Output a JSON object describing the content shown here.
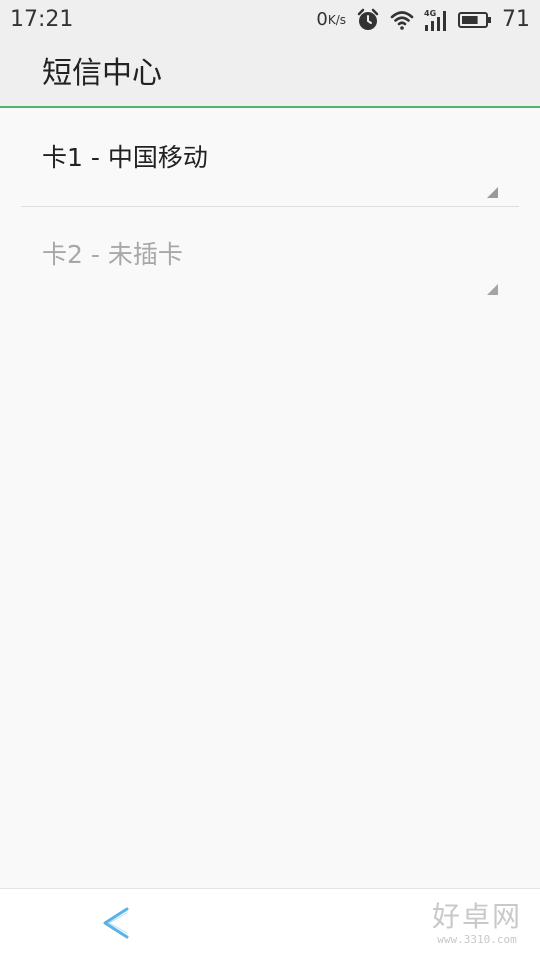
{
  "status_bar": {
    "time": "17:21",
    "net_speed_value": "0",
    "net_speed_unit": "K/s",
    "battery_level": "71",
    "icons": [
      "alarm-icon",
      "wifi-icon",
      "4g-signal-icon",
      "battery-icon"
    ]
  },
  "header": {
    "title": "短信中心"
  },
  "sim_list": [
    {
      "label": "卡1 - 中国移动",
      "enabled": true
    },
    {
      "label": "卡2 - 未插卡",
      "enabled": false
    }
  ],
  "nav": {
    "back_icon": "back-chevron-icon"
  },
  "watermark": {
    "name": "好卓网",
    "url": "www.3310.com"
  },
  "colors": {
    "accent": "#52b36d",
    "background": "#f9f9f9",
    "bar_background": "#efefef",
    "back_icon": "#5ab2e6",
    "text_primary": "#222222",
    "text_disabled": "#a8a8a8"
  }
}
